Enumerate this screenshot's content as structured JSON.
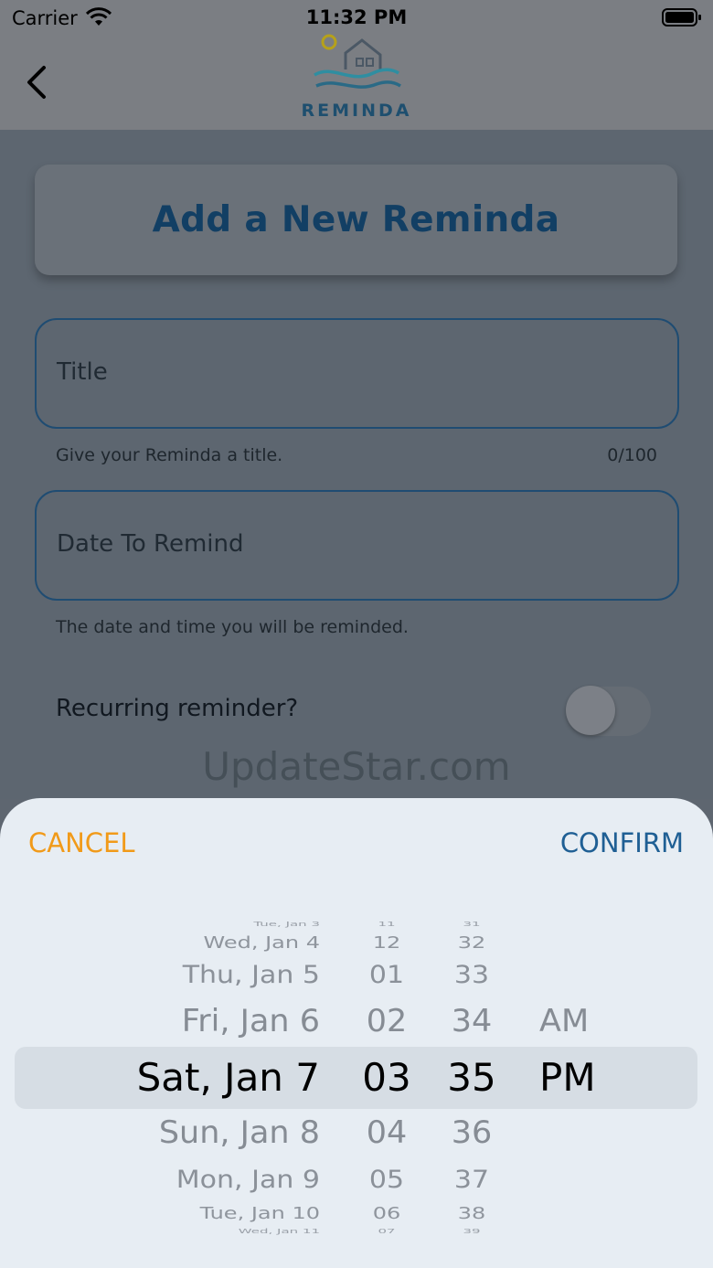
{
  "status_bar": {
    "carrier": "Carrier",
    "time": "11:32 PM"
  },
  "header": {
    "logo_text": "REMINDA"
  },
  "form": {
    "card_title": "Add a New Reminda",
    "title_field": {
      "label": "Title",
      "helper": "Give your Reminda a title.",
      "counter": "0/100"
    },
    "date_field": {
      "label": "Date To Remind",
      "helper": "The date and time you will be reminded."
    },
    "recurring": {
      "label": "Recurring reminder?",
      "enabled": false
    }
  },
  "watermark": "UpdateStar.com",
  "picker": {
    "cancel_label": "CANCEL",
    "confirm_label": "CONFIRM",
    "rows": [
      {
        "date": "Tue, Jan 3",
        "hour": "11",
        "minute": "31",
        "ampm": ""
      },
      {
        "date": "Wed, Jan 4",
        "hour": "12",
        "minute": "32",
        "ampm": ""
      },
      {
        "date": "Thu, Jan 5",
        "hour": "01",
        "minute": "33",
        "ampm": ""
      },
      {
        "date": "Fri, Jan 6",
        "hour": "02",
        "minute": "34",
        "ampm": "AM"
      },
      {
        "date": "Sat, Jan 7",
        "hour": "03",
        "minute": "35",
        "ampm": "PM"
      },
      {
        "date": "Sun, Jan 8",
        "hour": "04",
        "minute": "36",
        "ampm": ""
      },
      {
        "date": "Mon, Jan 9",
        "hour": "05",
        "minute": "37",
        "ampm": ""
      },
      {
        "date": "Tue, Jan 10",
        "hour": "06",
        "minute": "38",
        "ampm": ""
      },
      {
        "date": "Wed, Jan 11",
        "hour": "07",
        "minute": "39",
        "ampm": ""
      }
    ],
    "selected_index": 4
  },
  "colors": {
    "accent_orange": "#f19a19",
    "accent_blue": "#1f5f94",
    "title_blue": "#123f64"
  }
}
